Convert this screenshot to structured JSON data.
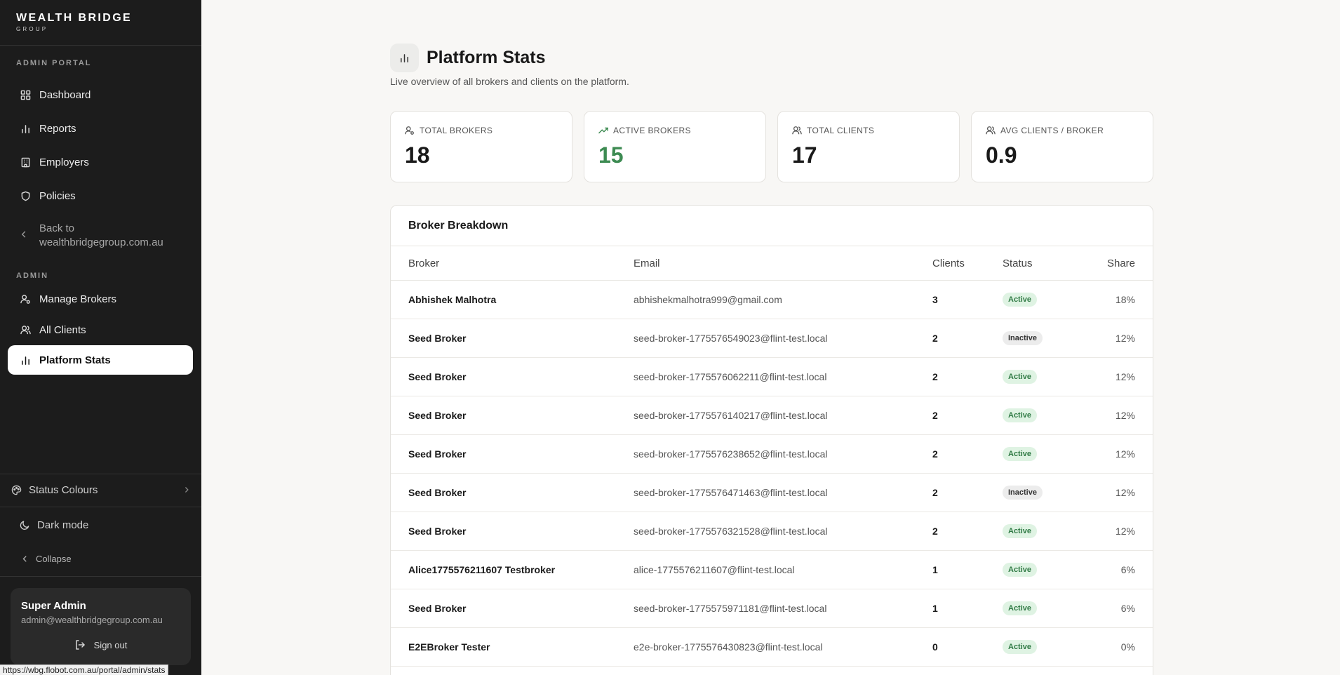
{
  "brand": {
    "name": "WEALTH BRIDGE",
    "sub": "GROUP"
  },
  "sidebar": {
    "portal_label": "ADMIN PORTAL",
    "items": [
      {
        "label": "Dashboard",
        "icon": "grid-icon"
      },
      {
        "label": "Reports",
        "icon": "bar-chart-icon"
      },
      {
        "label": "Employers",
        "icon": "building-icon"
      },
      {
        "label": "Policies",
        "icon": "shield-icon"
      }
    ],
    "back_label": "Back to wealthbridgegroup.com.au",
    "admin_label": "ADMIN",
    "admin_items": [
      {
        "label": "Manage Brokers",
        "icon": "user-cog-icon"
      },
      {
        "label": "All Clients",
        "icon": "users-icon"
      },
      {
        "label": "Platform Stats",
        "icon": "bar-chart-icon",
        "active": true
      }
    ],
    "status_colours": "Status Colours",
    "dark_mode": "Dark mode",
    "collapse": "Collapse",
    "user": {
      "name": "Super Admin",
      "email": "admin@wealthbridgegroup.com.au",
      "sign_out": "Sign out"
    }
  },
  "status_url": "https://wbg.flobot.com.au/portal/admin/stats",
  "page": {
    "title": "Platform Stats",
    "subtitle": "Live overview of all brokers and clients on the platform."
  },
  "stats": [
    {
      "label": "TOTAL BROKERS",
      "value": "18",
      "icon": "user-cog-icon"
    },
    {
      "label": "ACTIVE BROKERS",
      "value": "15",
      "icon": "trending-up-icon",
      "accent": "#3d8b52"
    },
    {
      "label": "TOTAL CLIENTS",
      "value": "17",
      "icon": "users-icon"
    },
    {
      "label": "AVG CLIENTS / BROKER",
      "value": "0.9",
      "icon": "users-icon"
    }
  ],
  "table": {
    "title": "Broker Breakdown",
    "columns": {
      "broker": "Broker",
      "email": "Email",
      "clients": "Clients",
      "status": "Status",
      "share": "Share"
    },
    "rows": [
      {
        "broker": "Abhishek Malhotra",
        "email": "abhishekmalhotra999@gmail.com",
        "clients": "3",
        "status": "Active",
        "share": "18%"
      },
      {
        "broker": "Seed Broker",
        "email": "seed-broker-1775576549023@flint-test.local",
        "clients": "2",
        "status": "Inactive",
        "share": "12%"
      },
      {
        "broker": "Seed Broker",
        "email": "seed-broker-1775576062211@flint-test.local",
        "clients": "2",
        "status": "Active",
        "share": "12%"
      },
      {
        "broker": "Seed Broker",
        "email": "seed-broker-1775576140217@flint-test.local",
        "clients": "2",
        "status": "Active",
        "share": "12%"
      },
      {
        "broker": "Seed Broker",
        "email": "seed-broker-1775576238652@flint-test.local",
        "clients": "2",
        "status": "Active",
        "share": "12%"
      },
      {
        "broker": "Seed Broker",
        "email": "seed-broker-1775576471463@flint-test.local",
        "clients": "2",
        "status": "Inactive",
        "share": "12%"
      },
      {
        "broker": "Seed Broker",
        "email": "seed-broker-1775576321528@flint-test.local",
        "clients": "2",
        "status": "Active",
        "share": "12%"
      },
      {
        "broker": "Alice1775576211607 Testbroker",
        "email": "alice-1775576211607@flint-test.local",
        "clients": "1",
        "status": "Active",
        "share": "6%"
      },
      {
        "broker": "Seed Broker",
        "email": "seed-broker-1775575971181@flint-test.local",
        "clients": "1",
        "status": "Active",
        "share": "6%"
      },
      {
        "broker": "E2EBroker Tester",
        "email": "e2e-broker-1775576430823@flint-test.local",
        "clients": "0",
        "status": "Active",
        "share": "0%"
      }
    ]
  }
}
